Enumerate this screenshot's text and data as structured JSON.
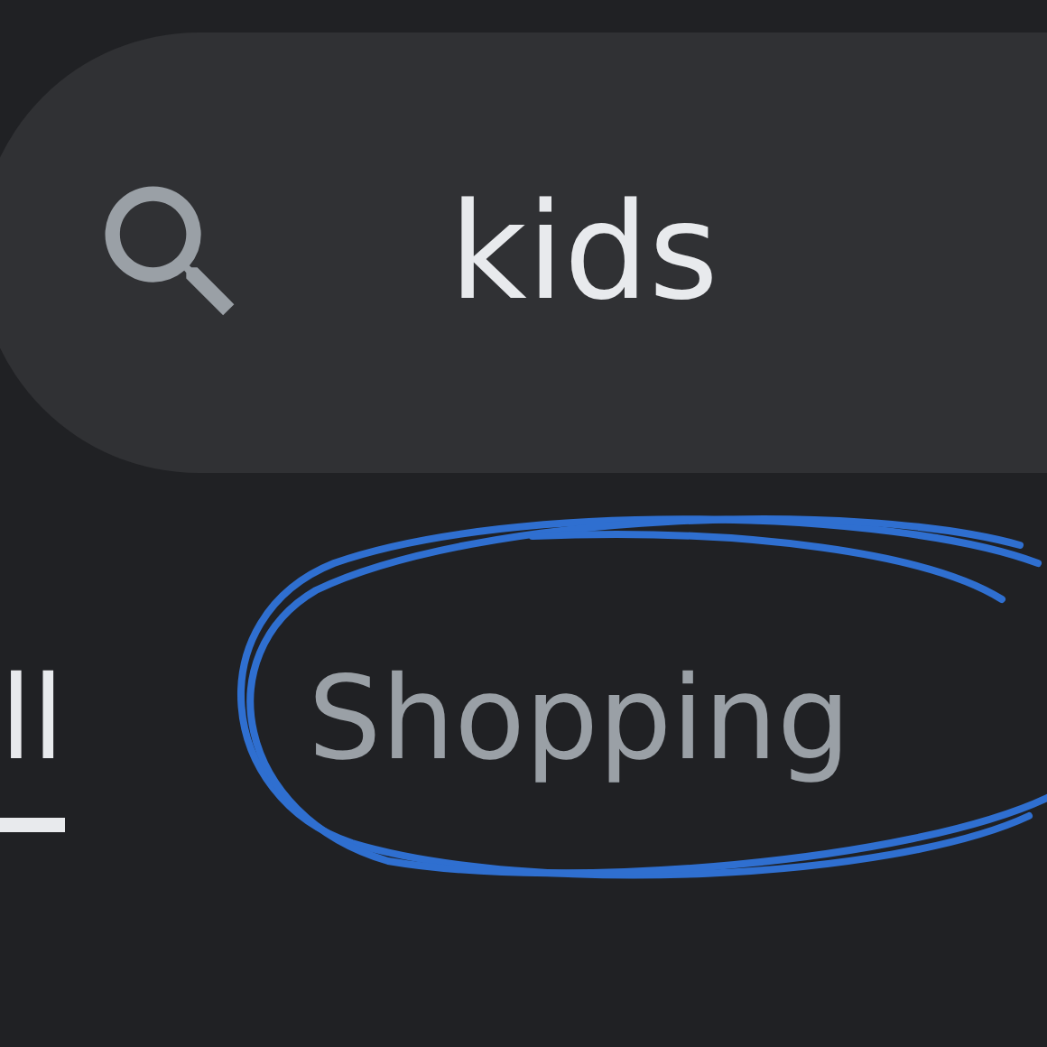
{
  "search": {
    "value": "kids"
  },
  "tabs": [
    {
      "label": "ll",
      "selected": true
    },
    {
      "label": "Shopping",
      "selected": false
    }
  ]
}
